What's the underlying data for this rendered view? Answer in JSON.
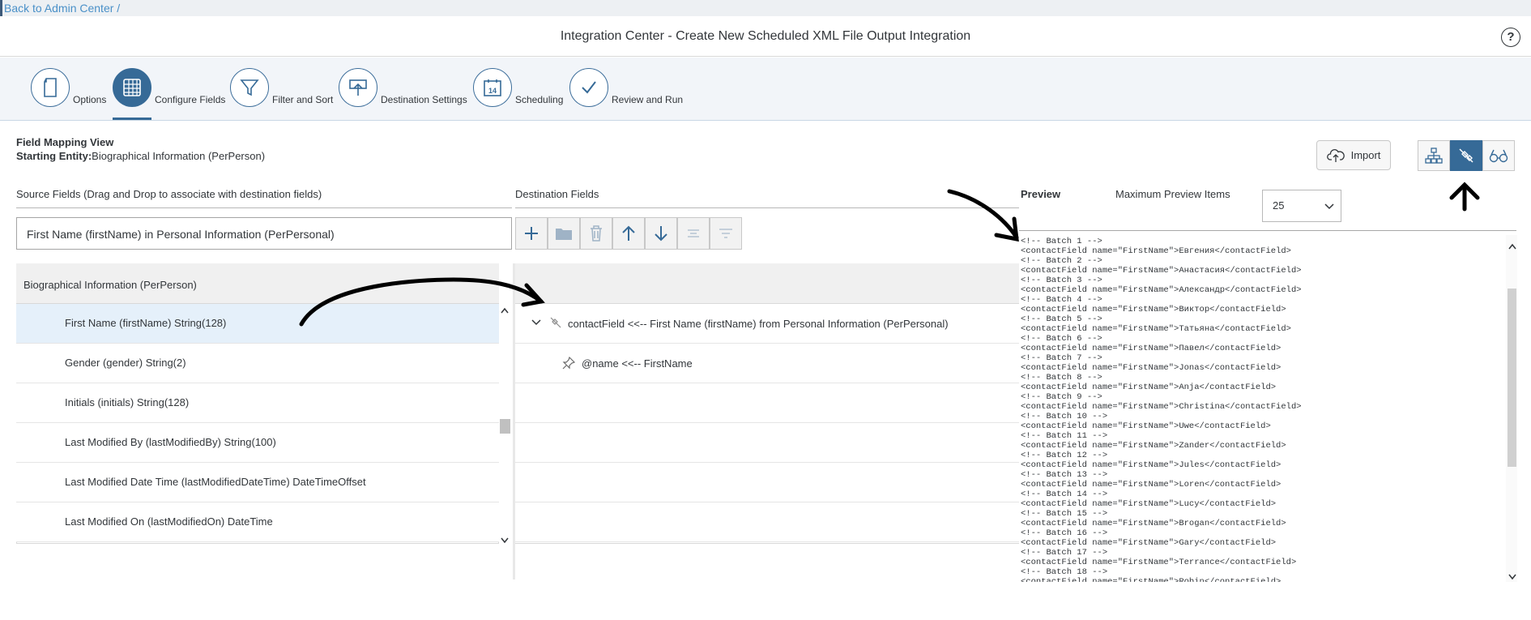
{
  "breadcrumb": {
    "back_label": "Back to Admin Center /"
  },
  "header": {
    "title": "Integration Center - Create New Scheduled XML File Output Integration",
    "help_symbol": "?"
  },
  "wizard": {
    "steps": [
      {
        "label": "Options",
        "icon": "document-icon"
      },
      {
        "label": "Configure Fields",
        "icon": "grid-icon",
        "active": true
      },
      {
        "label": "Filter and Sort",
        "icon": "filter-icon"
      },
      {
        "label": "Destination Settings",
        "icon": "upload-icon"
      },
      {
        "label": "Scheduling",
        "icon": "calendar-icon",
        "calendar_day": "14"
      },
      {
        "label": "Review and Run",
        "icon": "checkmark-icon"
      }
    ]
  },
  "field_mapping": {
    "title": "Field Mapping View",
    "entity_label": "Starting Entity:",
    "entity_value": "Biographical Information (PerPerson)",
    "import_label": "Import"
  },
  "source": {
    "header": "Source Fields (Drag and Drop to associate with destination fields)",
    "selected_field": "First Name (firstName) in Personal Information (PerPersonal)",
    "group": "Biographical Information (PerPerson)",
    "rows": [
      "First Name (firstName) String(128)",
      "Gender (gender) String(2)",
      "Initials (initials) String(128)",
      "Last Modified By (lastModifiedBy) String(100)",
      "Last Modified Date Time (lastModifiedDateTime) DateTimeOffset",
      "Last Modified On (lastModifiedOn) DateTime"
    ]
  },
  "destination": {
    "header": "Destination Fields",
    "rows": [
      "contactField <<-- First Name (firstName) from Personal Information (PerPersonal)",
      "@name <<-- FirstName"
    ]
  },
  "preview": {
    "header": "Preview",
    "max_label": "Maximum Preview Items",
    "max_value": "25",
    "lines": [
      "<!-- Batch 1 -->",
      "<contactField name=\"FirstName\">Евгения</contactField>",
      "<!-- Batch 2 -->",
      "<contactField name=\"FirstName\">Анастасия</contactField>",
      "<!-- Batch 3 -->",
      "<contactField name=\"FirstName\">Александр</contactField>",
      "<!-- Batch 4 -->",
      "<contactField name=\"FirstName\">Виктор</contactField>",
      "<!-- Batch 5 -->",
      "<contactField name=\"FirstName\">Татьяна</contactField>",
      "<!-- Batch 6 -->",
      "<contactField name=\"FirstName\">Павел</contactField>",
      "<!-- Batch 7 -->",
      "<contactField name=\"FirstName\">Jonas</contactField>",
      "<!-- Batch 8 -->",
      "<contactField name=\"FirstName\">Anja</contactField>",
      "<!-- Batch 9 -->",
      "<contactField name=\"FirstName\">Christina</contactField>",
      "<!-- Batch 10 -->",
      "<contactField name=\"FirstName\">Uwe</contactField>",
      "<!-- Batch 11 -->",
      "<contactField name=\"FirstName\">Zander</contactField>",
      "<!-- Batch 12 -->",
      "<contactField name=\"FirstName\">Jules</contactField>",
      "<!-- Batch 13 -->",
      "<contactField name=\"FirstName\">Loren</contactField>",
      "<!-- Batch 14 -->",
      "<contactField name=\"FirstName\">Lucy</contactField>",
      "<!-- Batch 15 -->",
      "<contactField name=\"FirstName\">Brogan</contactField>",
      "<!-- Batch 16 -->",
      "<contactField name=\"FirstName\">Gary</contactField>",
      "<!-- Batch 17 -->",
      "<contactField name=\"FirstName\">Terrance</contactField>",
      "<!-- Batch 18 -->",
      "<contactField name=\"FirstName\">Robin</contactField>"
    ]
  },
  "colors": {
    "accent": "#366a97",
    "link": "#4a90c8"
  }
}
